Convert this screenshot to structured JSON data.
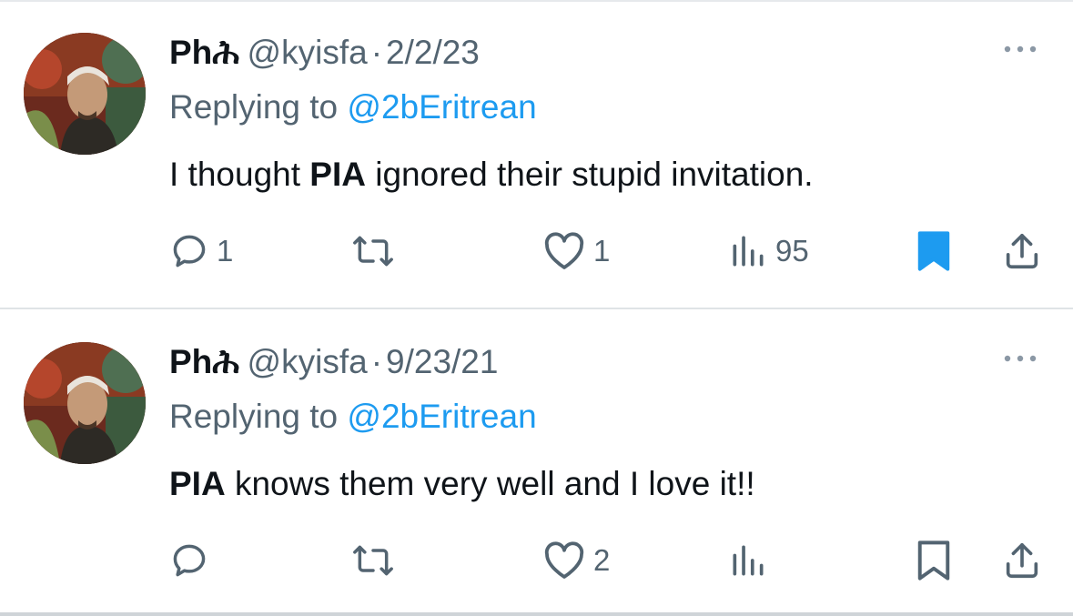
{
  "colors": {
    "link": "#1d9bf0",
    "muted": "#536471",
    "bookmark_active": "#1d9bf0"
  },
  "tweets": [
    {
      "name": "Phሕ",
      "handle": "@kyisfa",
      "separator": "·",
      "date": "2/2/23",
      "replying_prefix": "Replying to",
      "replying_to": "@2bEritrean",
      "text_bold": "",
      "text_pre": "I thought ",
      "text_bold_mid": "PIA",
      "text_post": " ignored their stupid invitation.",
      "reply_count": "1",
      "retweet_count": "",
      "like_count": "1",
      "view_count": "95",
      "bookmarked": true,
      "icons": [
        "reply-icon",
        "retweet-icon",
        "like-icon",
        "views-icon",
        "bookmark-icon",
        "share-icon",
        "more-icon"
      ]
    },
    {
      "name": "Phሕ",
      "handle": "@kyisfa",
      "separator": "·",
      "date": "9/23/21",
      "replying_prefix": "Replying to",
      "replying_to": "@2bEritrean",
      "text_bold": "PIA",
      "text_post": " knows them very well and I love it!!",
      "reply_count": "",
      "retweet_count": "",
      "like_count": "2",
      "view_count": "",
      "bookmarked": false,
      "icons": [
        "reply-icon",
        "retweet-icon",
        "like-icon",
        "views-icon",
        "bookmark-icon",
        "share-icon",
        "more-icon"
      ]
    }
  ]
}
